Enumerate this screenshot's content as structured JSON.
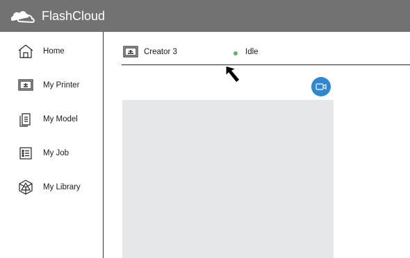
{
  "app": {
    "title": "FlashCloud"
  },
  "sidebar": {
    "items": [
      {
        "label": "Home",
        "icon": "home-icon"
      },
      {
        "label": "My Printer",
        "icon": "printer-icon"
      },
      {
        "label": "My Model",
        "icon": "model-icon"
      },
      {
        "label": "My Job",
        "icon": "job-list-icon"
      },
      {
        "label": "My Library",
        "icon": "library-icon"
      }
    ]
  },
  "printer": {
    "name": "Creator 3",
    "status": "Idle",
    "status_color": "#5cb85c"
  },
  "colors": {
    "topbar": "#727272",
    "accent": "#2f86d1",
    "camera_placeholder": "#e6e7e8"
  }
}
